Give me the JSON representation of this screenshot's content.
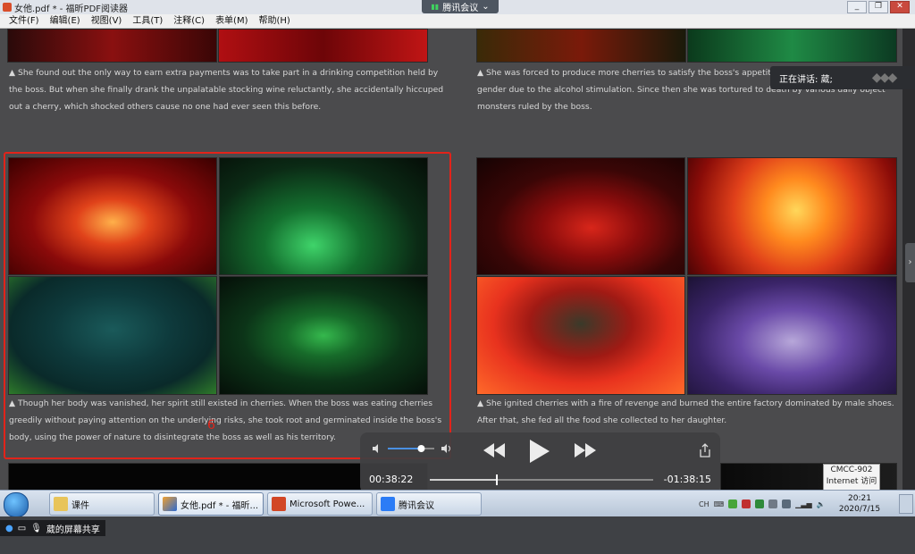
{
  "window": {
    "title": "女他.pdf * - 福昕PDF阅读器",
    "meeting_label": "腾讯会议"
  },
  "menu": [
    "文件(F)",
    "编辑(E)",
    "视图(V)",
    "工具(T)",
    "注释(C)",
    "表单(M)",
    "帮助(H)"
  ],
  "captions": {
    "top_left": [
      "▲ She found out the only way to earn extra payments was to take part in a drinking competition held by",
      "the boss. But when she finally drank the unpalatable stocking wine reluctantly, she accidentally hiccuped",
      "out a cherry, which shocked others cause no one had ever seen this before."
    ],
    "top_right": [
      "▲ She was forced to produce more cherries to satisfy the boss's appetit",
      "gender due to the alcohol stimulation. Since then she was tortured to death by various daily object",
      "monsters ruled by the boss."
    ],
    "mid_left": [
      "▲ Though her body was vanished, her spirit still existed in cherries. When the boss was eating cherries",
      "greedily without paying attention on the underlying risks, she took root and germinated inside the boss's",
      "body, using the power of nature to disintegrate the boss as well as his territory."
    ],
    "mid_right": [
      "▲ She ignited cherries with a fire of revenge and burned the entire factory dominated by male shoes.",
      "After that, she fed all the food she collected to her daughter."
    ]
  },
  "annotation_mark": "6",
  "speaking": {
    "label": "正在讲话: 葳;"
  },
  "player": {
    "elapsed": "00:38:22",
    "remaining": "-01:38:15",
    "progress": 0.3,
    "volume": 0.72
  },
  "cmcc": {
    "line1": "CMCC-902",
    "line2": "Internet 访问"
  },
  "taskbar": {
    "items": [
      {
        "label": "课件"
      },
      {
        "label": "女他.pdf * - 福昕..."
      },
      {
        "label": "Microsoft Powe..."
      },
      {
        "label": "腾讯会议"
      }
    ],
    "ime": "CH",
    "time": "20:21",
    "date": "2020/7/15"
  },
  "share_bar": {
    "label": "葳的屏幕共享"
  },
  "colors": {
    "annotation": "#e2231a",
    "accent": "#1c5ca8"
  }
}
